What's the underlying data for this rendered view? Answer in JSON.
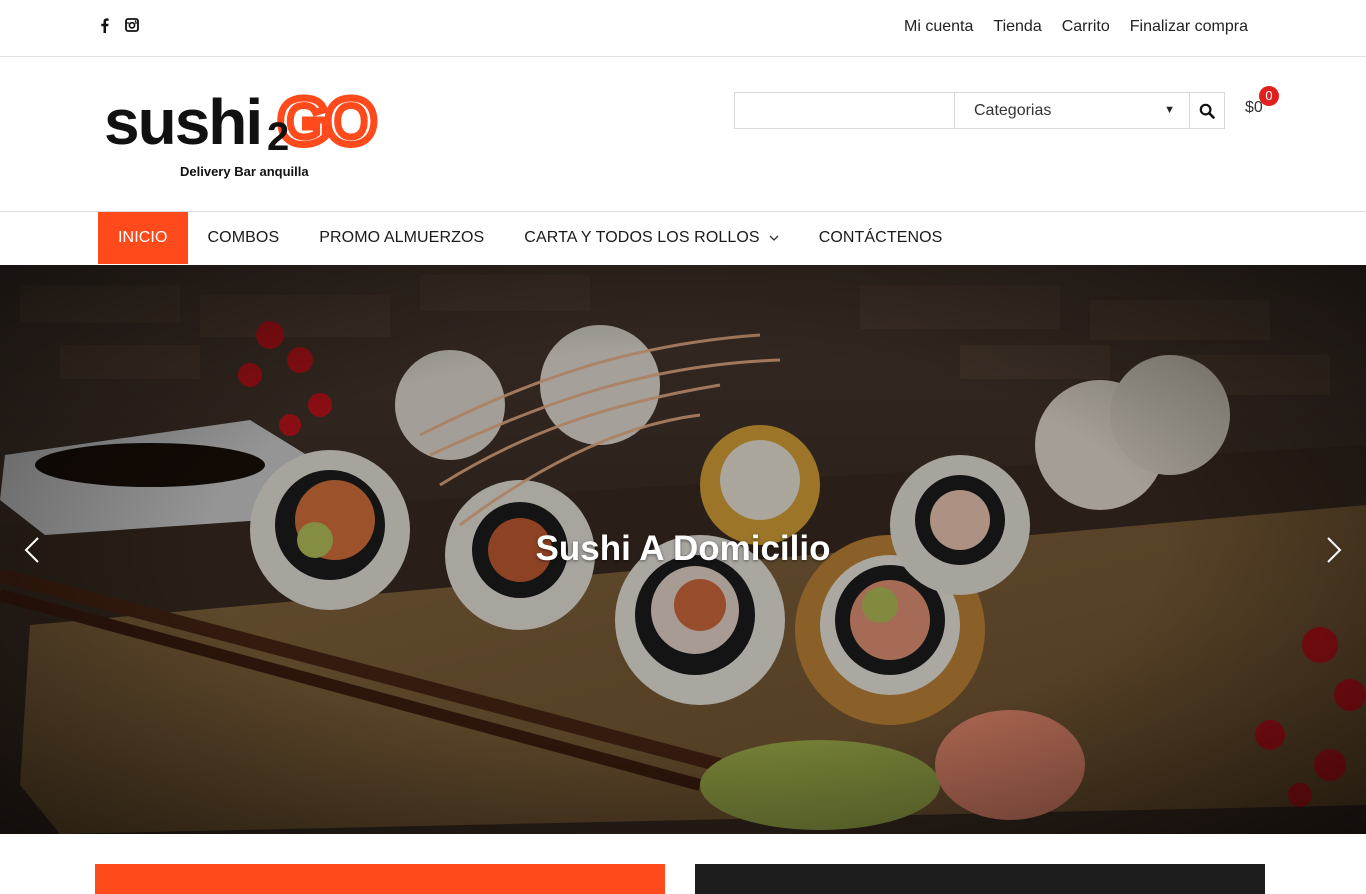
{
  "topbar": {
    "social": [
      {
        "icon": "facebook-icon"
      },
      {
        "icon": "instagram-icon"
      }
    ],
    "links": [
      "Mi cuenta",
      "Tienda",
      "Carrito",
      "Finalizar compra"
    ]
  },
  "logo": {
    "main": "sushi",
    "two": "2",
    "go": "GO",
    "tagline": "Delivery Bar anquilla",
    "go_color": "#ff4a1c"
  },
  "search": {
    "value": "",
    "category": "Categorias"
  },
  "cart": {
    "total": "$0",
    "count": "0"
  },
  "nav": {
    "items": [
      {
        "label": "INICIO"
      },
      {
        "label": "COMBOS"
      },
      {
        "label": "PROMO ALMUERZOS"
      },
      {
        "label": "CARTA Y TODOS LOS ROLLOS"
      },
      {
        "label": "CONTÁCTENOS"
      }
    ],
    "active_index": 0,
    "accent": "#ff4a1c"
  },
  "hero": {
    "title": "Sushi A Domicilio"
  }
}
